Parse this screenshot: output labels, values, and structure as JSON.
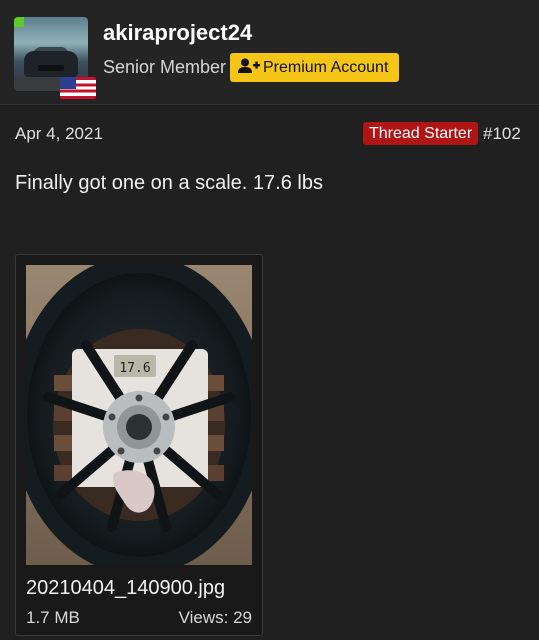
{
  "user": {
    "username": "akiraproject24",
    "title": "Senior Member",
    "premium_label": "Premium Account",
    "flag": "us-flag",
    "avatar": "car-avatar"
  },
  "post": {
    "date": "Apr 4, 2021",
    "badge": "Thread Starter",
    "number": "#102",
    "text": "Finally got one on a scale. 17.6 lbs"
  },
  "attachment": {
    "filename": "20210404_140900.jpg",
    "size": "1.7 MB",
    "views": "Views: 29",
    "scale_display": "17.6"
  },
  "colors": {
    "background": "#202020",
    "premium_badge": "#f5c518",
    "thread_starter_badge": "#b01515"
  }
}
